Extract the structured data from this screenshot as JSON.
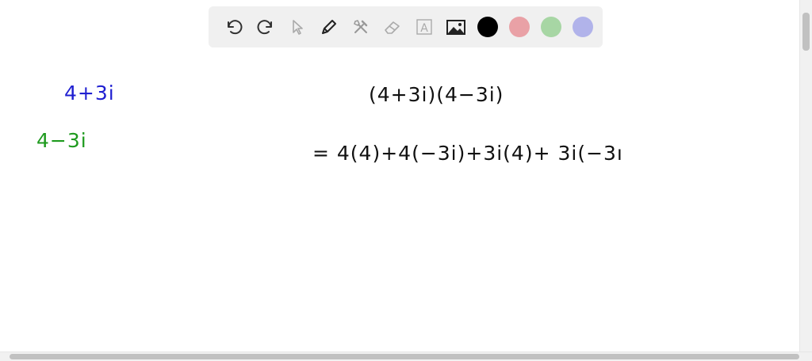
{
  "toolbar": {
    "tools": [
      {
        "name": "undo-icon"
      },
      {
        "name": "redo-icon"
      },
      {
        "name": "pointer-icon"
      },
      {
        "name": "pen-icon"
      },
      {
        "name": "tools-icon"
      },
      {
        "name": "eraser-icon"
      },
      {
        "name": "text-icon",
        "glyph": "A"
      },
      {
        "name": "image-icon"
      }
    ],
    "colors": [
      "#000000",
      "#e9a1a6",
      "#a7d6a4",
      "#b1b3ea"
    ]
  },
  "canvas": {
    "left_notes": [
      {
        "text": "4+3i",
        "color": "#1f1fd1"
      },
      {
        "text": "4−3i",
        "color": "#1e9a1e"
      }
    ],
    "work": {
      "line1": "(4+3i)(4−3i)",
      "line2": "= 4(4)+4(−3i)+3i(4)+ 3i(−3ı"
    }
  }
}
